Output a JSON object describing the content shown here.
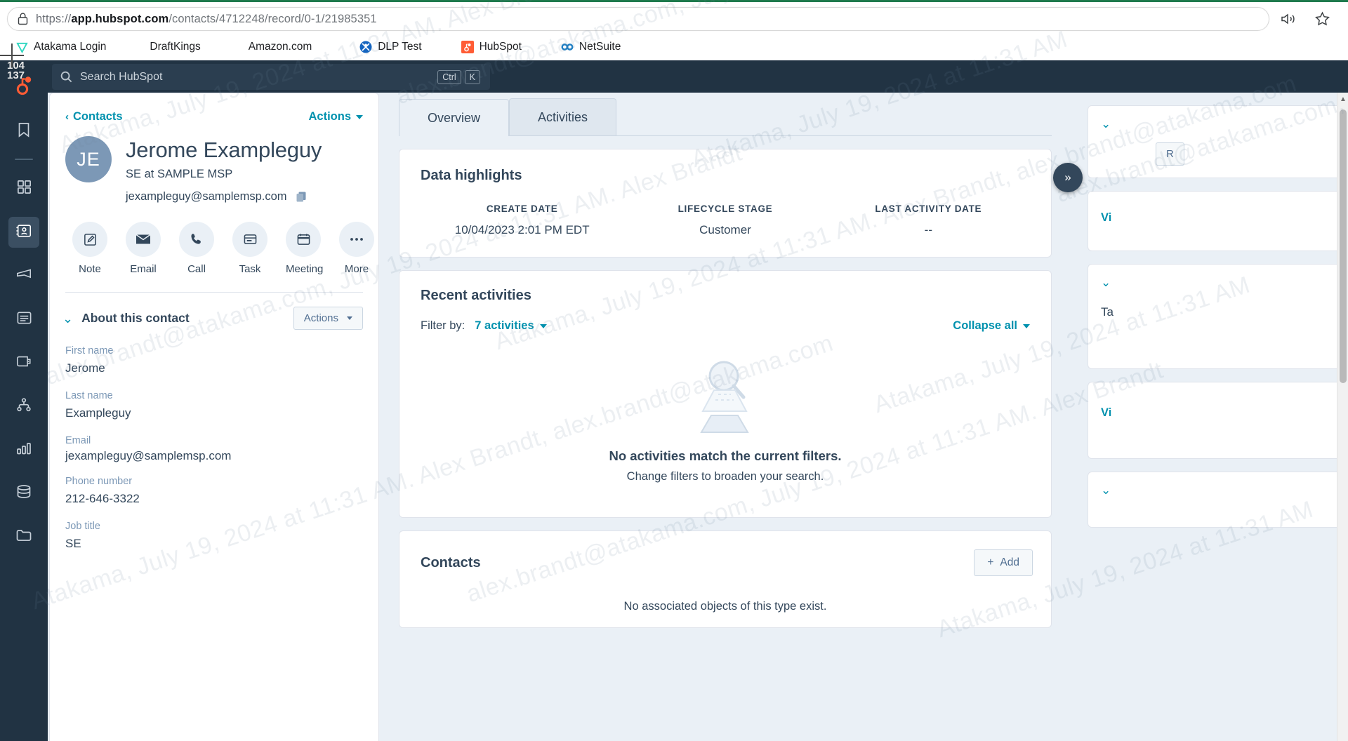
{
  "browser": {
    "url_scheme": "https://",
    "url_host": "app.hubspot.com",
    "url_path": "/contacts/4712248/record/0-1/21985351",
    "lock_icon": "lock-icon",
    "read_aloud_icon": "read-aloud-icon",
    "favorite_icon": "star-icon",
    "bookmarks": [
      {
        "label": "Atakama Login",
        "icon": "atakama-triangle-icon"
      },
      {
        "label": "DraftKings",
        "icon": "no-icon"
      },
      {
        "label": "Amazon.com",
        "icon": "no-icon"
      },
      {
        "label": "DLP Test",
        "icon": "dlp-circle-icon"
      },
      {
        "label": "HubSpot",
        "icon": "hubspot-square-icon"
      },
      {
        "label": "NetSuite",
        "icon": "netsuite-icon"
      }
    ]
  },
  "cursor": {
    "x_label": "104",
    "y_label": "137"
  },
  "topbar": {
    "search_placeholder": "Search HubSpot",
    "search_icon": "search-icon",
    "shortcut_keys": [
      "Ctrl",
      "K"
    ]
  },
  "leftnav": {
    "logo_icon": "hubspot-logo-icon",
    "items": [
      {
        "name": "bookmarks",
        "icon": "bookmark-icon",
        "active": false
      },
      {
        "name": "workspaces",
        "icon": "grid-apps-icon",
        "active": false
      },
      {
        "name": "contacts",
        "icon": "contacts-card-icon",
        "active": true
      },
      {
        "name": "marketing",
        "icon": "megaphone-icon",
        "active": false
      },
      {
        "name": "content",
        "icon": "content-page-icon",
        "active": false
      },
      {
        "name": "commerce",
        "icon": "wallet-icon",
        "active": false
      },
      {
        "name": "automation",
        "icon": "workflow-nodes-icon",
        "active": false
      },
      {
        "name": "reporting",
        "icon": "bar-chart-icon",
        "active": false
      },
      {
        "name": "data-management",
        "icon": "database-icon",
        "active": false
      },
      {
        "name": "library",
        "icon": "folder-icon",
        "active": false
      }
    ]
  },
  "contact_panel": {
    "breadcrumb": "Contacts",
    "breadcrumb_back_icon": "chevron-left-icon",
    "actions_label": "Actions",
    "avatar_initials": "JE",
    "name": "Jerome Exampleguy",
    "subtitle": "SE at SAMPLE MSP",
    "email": "jexampleguy@samplemsp.com",
    "copy_icon": "copy-icon",
    "quick_actions": [
      {
        "label": "Note",
        "icon": "note-pencil-icon"
      },
      {
        "label": "Email",
        "icon": "envelope-icon"
      },
      {
        "label": "Call",
        "icon": "phone-icon"
      },
      {
        "label": "Task",
        "icon": "task-board-icon"
      },
      {
        "label": "Meeting",
        "icon": "calendar-icon"
      },
      {
        "label": "More",
        "icon": "ellipsis-icon"
      }
    ],
    "about_title": "About this contact",
    "about_actions_label": "Actions",
    "fields": [
      {
        "label": "First name",
        "value": "Jerome"
      },
      {
        "label": "Last name",
        "value": "Exampleguy"
      },
      {
        "label": "Email",
        "value": "jexampleguy@samplemsp.com"
      },
      {
        "label": "Phone number",
        "value": "212-646-3322"
      },
      {
        "label": "Job title",
        "value": "SE"
      }
    ]
  },
  "main": {
    "tabs": [
      {
        "label": "Overview",
        "active": true
      },
      {
        "label": "Activities",
        "active": false
      }
    ],
    "data_highlights": {
      "title": "Data highlights",
      "columns": [
        {
          "key": "CREATE DATE",
          "value": "10/04/2023 2:01 PM EDT"
        },
        {
          "key": "LIFECYCLE STAGE",
          "value": "Customer"
        },
        {
          "key": "LAST ACTIVITY DATE",
          "value": "--"
        }
      ]
    },
    "recent_activities": {
      "title": "Recent activities",
      "filter_label": "Filter by:",
      "filter_value": "7 activities",
      "collapse_label": "Collapse all",
      "empty_title": "No activities match the current filters.",
      "empty_subtitle": "Change filters to broaden your search.",
      "empty_icon": "magnifier-search-illustration"
    },
    "contacts_card": {
      "title": "Contacts",
      "add_label": "Add",
      "add_icon": "plus-icon",
      "empty_text": "No associated objects of this type exist."
    }
  },
  "right_panel": {
    "expand_icon": "double-chevron-right-icon",
    "rows": [
      {
        "type": "chevron",
        "label": ""
      },
      {
        "type": "button",
        "label": "R"
      },
      {
        "type": "link",
        "label": "Vi"
      },
      {
        "type": "chevron",
        "label": ""
      },
      {
        "type": "text",
        "label": "Ta"
      },
      {
        "type": "link",
        "label": "Vi"
      },
      {
        "type": "chevron",
        "label": ""
      }
    ]
  },
  "watermark": {
    "text_a": "Atakama, July 19, 2024 at 11:31 AM. Alex Brandt, alex.brandt@atakama.com",
    "text_b": "alex.brandt@atakama.com, July 19, 2024 at 11:31 AM. Alex Brandt",
    "text_c": "Atakama, July 19, 2024 at 11:31 AM"
  }
}
